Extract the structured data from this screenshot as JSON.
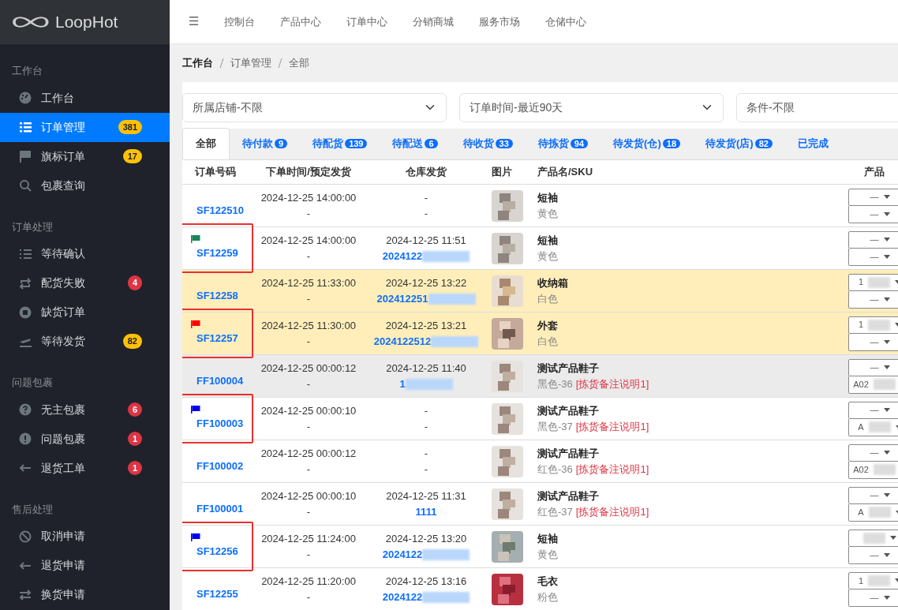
{
  "brand": "LoopHot",
  "sidebar": [
    {
      "heading": "工作台",
      "items": [
        {
          "label": "工作台",
          "selected": false
        },
        {
          "label": "订单管理",
          "badge": "381",
          "color": "#ffc107",
          "selected": true
        },
        {
          "label": "旗标订单",
          "badge": "17",
          "color": "#ffc107",
          "selected": false
        },
        {
          "label": "包裹查询",
          "selected": false
        }
      ]
    },
    {
      "heading": "订单处理",
      "items": [
        {
          "label": "等待确认",
          "selected": false
        },
        {
          "label": "配货失败",
          "badge": "4",
          "color": "#dc3545",
          "selected": false
        },
        {
          "label": "缺货订单",
          "selected": false
        },
        {
          "label": "等待发货",
          "badge": "82",
          "color": "#ffc107",
          "selected": false
        }
      ]
    },
    {
      "heading": "问题包裹",
      "items": [
        {
          "label": "无主包裹",
          "badge": "6",
          "color": "#dc3545",
          "selected": false
        },
        {
          "label": "问题包裹",
          "badge": "1",
          "color": "#dc3545",
          "selected": false
        },
        {
          "label": "退货工单",
          "badge": "1",
          "color": "#dc3545",
          "selected": false
        }
      ]
    },
    {
      "heading": "售后处理",
      "items": [
        {
          "label": "取消申请",
          "selected": false
        },
        {
          "label": "退货申请",
          "selected": false
        },
        {
          "label": "换货申请",
          "selected": false
        }
      ]
    }
  ],
  "menu_icon": "☰",
  "topnav": [
    "控制台",
    "产品中心",
    "订单中心",
    "分销商城",
    "服务市场",
    "仓储中心"
  ],
  "breadcrumb": [
    "工作台",
    "订单管理",
    "全部"
  ],
  "filters": [
    "所属店铺-不限",
    "订单时间-最近90天",
    "条件-不限"
  ],
  "tabs": [
    {
      "label": "全部",
      "selected": true
    },
    {
      "label": "待付款",
      "count": "9",
      "selected": false
    },
    {
      "label": "待配货",
      "count": "139",
      "selected": false
    },
    {
      "label": "待配送",
      "count": "6",
      "selected": false
    },
    {
      "label": "待收货",
      "count": "33",
      "selected": false
    },
    {
      "label": "待拣货",
      "count": "94",
      "selected": false
    },
    {
      "label": "待发货(仓)",
      "count": "18",
      "selected": false
    },
    {
      "label": "待发货(店)",
      "count": "82",
      "selected": false
    },
    {
      "label": "已完成",
      "selected": false
    }
  ],
  "table": {
    "columns": [
      "订单号码",
      "下单时间/预定发货",
      "仓库发货",
      "图片",
      "产品名/SKU",
      "产品"
    ],
    "rows": [
      {
        "order": "SF122510",
        "highlighted": false,
        "color": "#ffffff",
        "time": "2024-12-25 14:00:00",
        "planned": "-",
        "ship_time": "-",
        "tracking": "-",
        "tracking_link": false,
        "product": "短袖",
        "sku": "黄色",
        "selects": [
          {
            "value": "—"
          },
          {
            "value": "—"
          }
        ]
      },
      {
        "order": "SF12259",
        "flag": {
          "color": "#198754"
        },
        "highlighted": true,
        "color": "#ffffff",
        "time": "2024-12-25 14:00:00",
        "planned": "-",
        "ship_time": "2024-12-25 11:51",
        "tracking": "2024122",
        "tracking_link": true,
        "redacted": true,
        "product": "短袖",
        "sku": "黄色",
        "selects": [
          {
            "value": "—"
          },
          {
            "value": "—"
          }
        ]
      },
      {
        "order": "SF12258",
        "highlighted": false,
        "color": "#ffeeba",
        "time": "2024-12-25 11:33:00",
        "planned": "-",
        "ship_time": "2024-12-25 13:22",
        "tracking": "202412251",
        "tracking_link": true,
        "redacted": true,
        "product": "收纳箱",
        "sku": "白色",
        "selects": [
          {
            "value": "1",
            "redacted": true
          },
          {
            "value": "—"
          }
        ]
      },
      {
        "order": "SF12257",
        "flag": {
          "color": "#ff0000"
        },
        "highlighted": true,
        "color": "#ffeeba",
        "time": "2024-12-25 11:30:00",
        "planned": "-",
        "ship_time": "2024-12-25 13:21",
        "tracking": "2024122512",
        "tracking_link": true,
        "redacted": true,
        "product": "外套",
        "sku": "白色",
        "selects": [
          {
            "value": "1",
            "redacted": true
          },
          {
            "value": "—"
          }
        ]
      },
      {
        "order": "FF100004",
        "highlighted": false,
        "color": "#ebebeb",
        "time": "2024-12-25 00:00:12",
        "planned": "-",
        "ship_time": "2024-12-25 11:40",
        "tracking": "1",
        "tracking_link": true,
        "redacted": true,
        "product": "测试产品鞋子",
        "sku": "黑色-36",
        "note": "[拣货备注说明1]",
        "selects": [
          {
            "value": "—"
          },
          {
            "value": "A02",
            "redacted": true
          }
        ]
      },
      {
        "order": "FF100003",
        "flag": {
          "color": "#0000ee"
        },
        "highlighted": true,
        "color": "#ffffff",
        "time": "2024-12-25 00:00:10",
        "planned": "-",
        "ship_time": "-",
        "tracking": "-",
        "tracking_link": false,
        "product": "测试产品鞋子",
        "sku": "黑色-37",
        "note": "[拣货备注说明1]",
        "selects": [
          {
            "value": "—"
          },
          {
            "value": "A",
            "redacted": true
          }
        ]
      },
      {
        "order": "FF100002",
        "highlighted": false,
        "color": "#ffffff",
        "time": "2024-12-25 00:00:12",
        "planned": "-",
        "ship_time": "-",
        "tracking": "-",
        "tracking_link": false,
        "product": "测试产品鞋子",
        "sku": "红色-36",
        "note": "[拣货备注说明1]",
        "selects": [
          {
            "value": "—"
          },
          {
            "value": "A02",
            "redacted": true
          }
        ]
      },
      {
        "order": "FF100001",
        "highlighted": false,
        "color": "#ffffff",
        "time": "2024-12-25 00:00:10",
        "planned": "-",
        "ship_time": "2024-12-25 11:31",
        "tracking": "1111",
        "tracking_link": true,
        "product": "测试产品鞋子",
        "sku": "红色-37",
        "note": "[拣货备注说明1]",
        "selects": [
          {
            "value": "—"
          },
          {
            "value": "A",
            "redacted": true
          }
        ]
      },
      {
        "order": "SF12256",
        "flag": {
          "color": "#0000ee"
        },
        "highlighted": true,
        "color": "#ffffff",
        "time": "2024-12-25 11:24:00",
        "planned": "-",
        "ship_time": "2024-12-25 13:20",
        "tracking": "2024122",
        "tracking_link": true,
        "redacted": true,
        "product": "短袖",
        "sku": "黄色",
        "selects": [
          {
            "redacted": true
          },
          {
            "value": "—"
          }
        ]
      },
      {
        "order": "SF12255",
        "highlighted": false,
        "color": "#ffffff",
        "time": "2024-12-25 11:20:00",
        "planned": "-",
        "ship_time": "2024-12-25 13:16",
        "tracking": "2024122",
        "tracking_link": true,
        "redacted": true,
        "product": "毛衣",
        "sku": "粉色",
        "selects": [
          {
            "value": "1",
            "redacted": true
          },
          {
            "value": "—"
          }
        ]
      }
    ]
  }
}
